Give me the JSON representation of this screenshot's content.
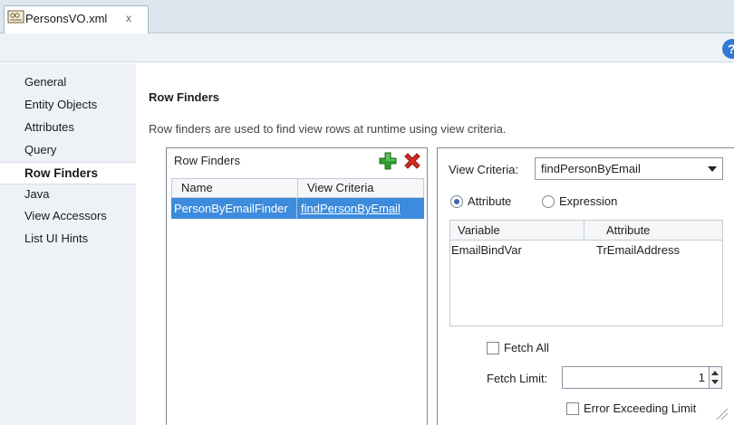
{
  "editor_tab": {
    "title": "PersonsVO.xml",
    "close": "x",
    "icon": "xml-file-icon"
  },
  "toolbar": {
    "help_label": "?"
  },
  "nav": {
    "items": [
      {
        "label": "General"
      },
      {
        "label": "Entity Objects"
      },
      {
        "label": "Attributes"
      },
      {
        "label": "Query"
      },
      {
        "label": "Row Finders",
        "selected": true
      },
      {
        "label": "Java"
      },
      {
        "label": "View Accessors"
      },
      {
        "label": "List UI Hints"
      }
    ]
  },
  "section": {
    "title": "Row Finders",
    "description": "Row finders are used to find view rows at runtime using view criteria."
  },
  "row_finders": {
    "header": "Row Finders",
    "add_icon": "add-icon",
    "delete_icon": "delete-icon",
    "columns": [
      "Name",
      "View Criteria"
    ],
    "rows": [
      {
        "name": "PersonByEmailFinder",
        "view_criteria": "findPersonByEmail",
        "selected": true
      }
    ]
  },
  "details": {
    "view_criteria_label": "View Criteria:",
    "view_criteria_value": "findPersonByEmail",
    "radio_attribute": "Attribute",
    "radio_expression": "Expression",
    "radio_selected": "Attribute",
    "columns": [
      "Variable",
      "Attribute"
    ],
    "rows": [
      {
        "variable": "EmailBindVar",
        "attribute": "TrEmailAddress"
      }
    ],
    "fetch_all_label": "Fetch All",
    "fetch_all_checked": false,
    "fetch_limit_label": "Fetch Limit:",
    "fetch_limit_value": "1",
    "error_exceeding_label": "Error Exceeding Limit",
    "error_exceeding_checked": false
  },
  "colors": {
    "selection": "#3d8bdc",
    "nav_bg": "#eef2f7",
    "tab_strip_bg": "#dde6ef",
    "add_green": "#2e9e2e",
    "delete_red": "#d8281e"
  }
}
